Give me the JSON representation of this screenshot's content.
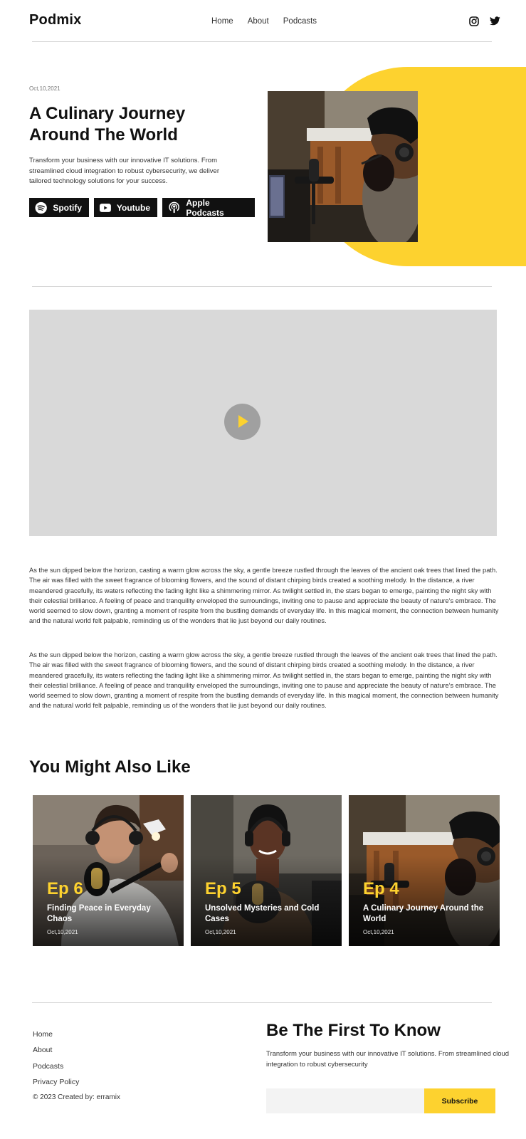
{
  "brand": {
    "logo": "Podmix",
    "accent": "#fdd22f"
  },
  "nav": {
    "items": [
      "Home",
      "About",
      "Podcasts"
    ]
  },
  "social": {
    "icons": [
      "instagram-icon",
      "twitter-icon"
    ]
  },
  "hero": {
    "date": "Oct,10,2021",
    "title_line1": "A Culinary Journey",
    "title_line2": "Around The World",
    "description": "Transform your business with our innovative IT solutions. From streamlined cloud integration to robust cybersecurity, we deliver tailored technology solutions for your success.",
    "platforms": [
      {
        "label": "Spotify",
        "icon": "spotify-icon"
      },
      {
        "label": "Youtube",
        "icon": "youtube-icon"
      },
      {
        "label": "Apple Podcasts",
        "icon": "apple-podcasts-icon"
      }
    ]
  },
  "video": {
    "play_icon": "play-icon"
  },
  "article": {
    "paragraphs": [
      "As the sun dipped below the horizon, casting a warm glow across the sky, a gentle breeze rustled through the leaves of the ancient oak trees that lined the path. The air was filled with the sweet fragrance of blooming flowers, and the sound of distant chirping birds created a soothing melody. In the distance, a river meandered gracefully, its waters reflecting the fading light like a shimmering mirror. As twilight settled in, the stars began to emerge, painting the night sky with their celestial brilliance. A feeling of peace and tranquility enveloped the surroundings, inviting one to pause and appreciate the beauty of nature's embrace. The world seemed to slow down, granting a moment of respite from the bustling demands of everyday life. In this magical moment, the connection between humanity and the natural world felt palpable, reminding us of the wonders that lie just beyond our daily routines.",
      "As the sun dipped below the horizon, casting a warm glow across the sky, a gentle breeze rustled through the leaves of the ancient oak trees that lined the path. The air was filled with the sweet fragrance of blooming flowers, and the sound of distant chirping birds created a soothing melody. In the distance, a river meandered gracefully, its waters reflecting the fading light like a shimmering mirror. As twilight settled in, the stars began to emerge, painting the night sky with their celestial brilliance. A feeling of peace and tranquility enveloped the surroundings, inviting one to pause and appreciate the beauty of nature's embrace. The world seemed to slow down, granting a moment of respite from the bustling demands of everyday life. In this magical moment, the connection between humanity and the natural world felt palpable, reminding us of the wonders that lie just beyond our daily routines."
    ]
  },
  "related": {
    "heading": "You Might Also Like",
    "cards": [
      {
        "ep": "Ep 6",
        "title": "Finding Peace in Everyday Chaos",
        "date": "Oct,10,2021"
      },
      {
        "ep": "Ep 5",
        "title": "Unsolved Mysteries and Cold Cases",
        "date": "Oct,10,2021"
      },
      {
        "ep": "Ep 4",
        "title": "A Culinary Journey Around the World",
        "date": "Oct,10,2021"
      }
    ]
  },
  "footer": {
    "links": [
      "Home",
      "About",
      "Podcasts",
      "Privacy Policy"
    ],
    "copyright": "© 2023 Created by: erramix",
    "subscribe": {
      "title": "Be The First To Know",
      "description": "Transform your business with our innovative IT solutions. From streamlined cloud integration to robust cybersecurity",
      "email_value": "",
      "button_label": "Subscribe"
    }
  }
}
